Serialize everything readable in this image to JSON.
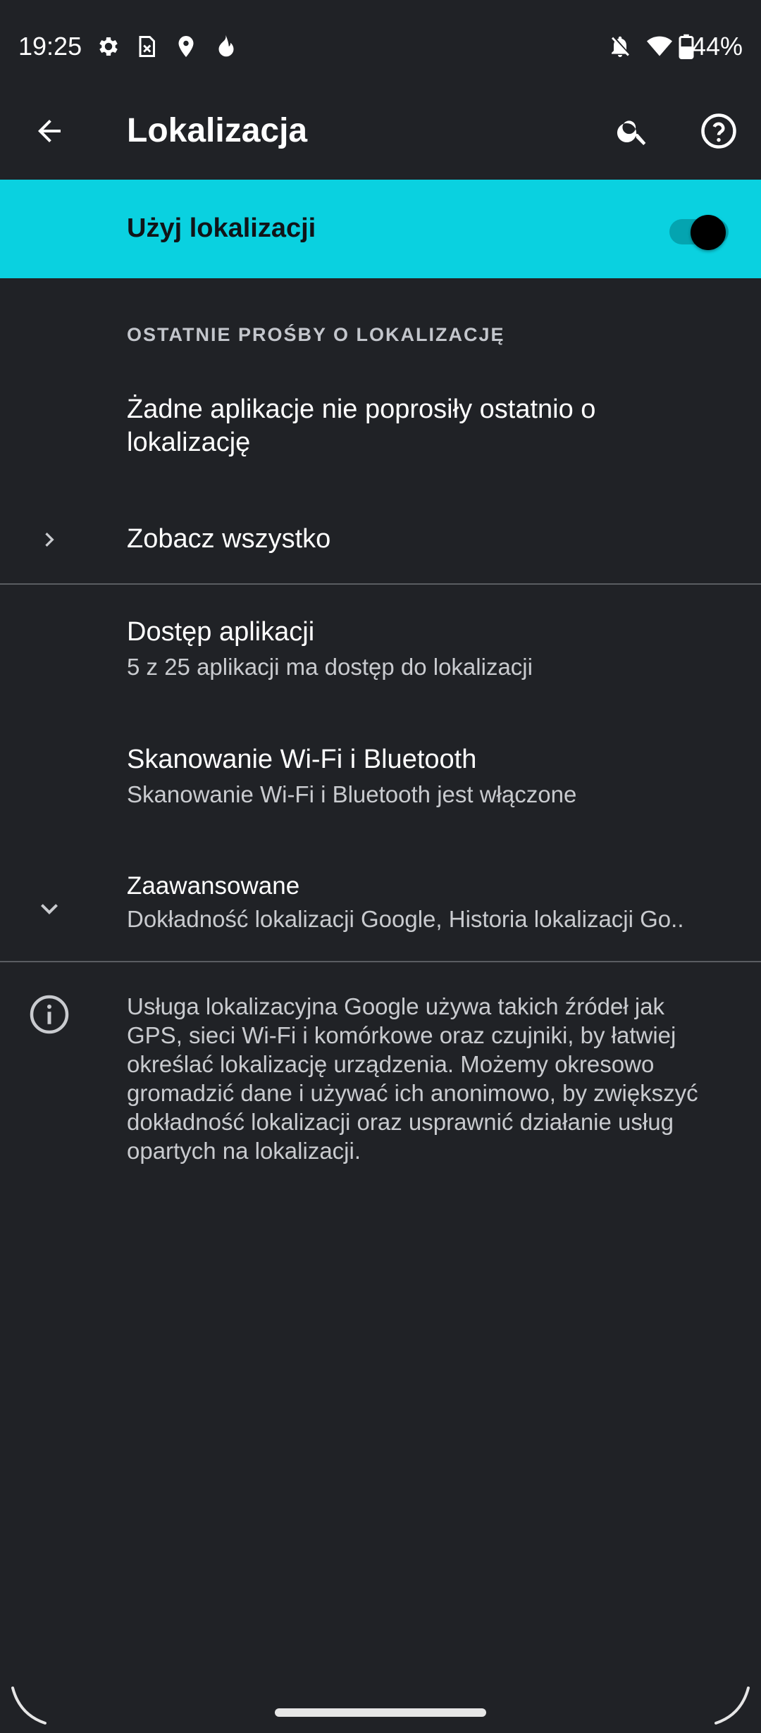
{
  "status_bar": {
    "time": "19:25",
    "battery": "44%",
    "icons": [
      "gear-icon",
      "sim-icon",
      "location-pin-icon",
      "fire-icon",
      "bell-off-icon",
      "wifi-icon",
      "battery-icon"
    ]
  },
  "app_bar": {
    "title": "Lokalizacja",
    "back_icon": "arrow-back-icon",
    "search_icon": "search-icon",
    "help_icon": "help-icon"
  },
  "main_toggle": {
    "label": "Użyj lokalizacji",
    "on": true,
    "banner_color": "#0ad1e0"
  },
  "recent_requests": {
    "header": "OSTATNIE PROŚBY O LOKALIZACJĘ",
    "empty_text": "Żadne aplikacje nie poprosiły ostatnio o lokalizację",
    "see_all": "Zobacz wszystko"
  },
  "settings": [
    {
      "title": "Dostęp aplikacji",
      "subtitle": "5 z 25 aplikacji ma dostęp do lokalizacji"
    },
    {
      "title": "Skanowanie Wi-Fi i Bluetooth",
      "subtitle": "Skanowanie Wi-Fi i Bluetooth jest włączone"
    },
    {
      "title": "Zaawansowane",
      "subtitle": "Dokładność lokalizacji Google, Historia lokalizacji Go.."
    }
  ],
  "info": {
    "text": "Usługa lokalizacyjna Google używa takich źródeł jak GPS, sieci Wi-Fi i komórkowe oraz czujniki, by łatwiej określać lokalizację urządzenia. Możemy okresowo gromadzić dane i używać ich anonimowo, by zwiększyć dokładność lokalizacji oraz usprawnić działanie usług opartych na lokalizacji."
  }
}
